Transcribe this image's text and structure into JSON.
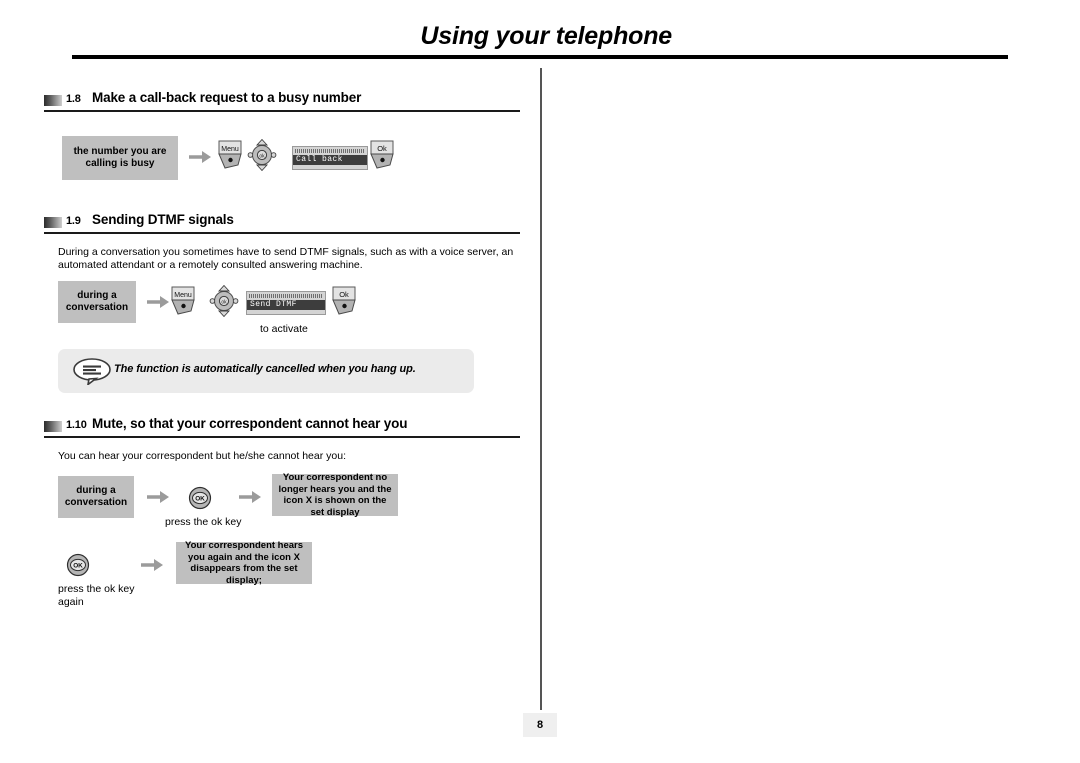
{
  "header": {
    "title": "Using your telephone"
  },
  "footer": {
    "page_number": "8"
  },
  "sections": [
    {
      "number": "1.8",
      "title": "Make a call-back request to a busy number",
      "steps": {
        "state_box": "the number you are calling is busy",
        "menu_key_label": "Menu",
        "lcd_text": "Call back",
        "ok_key_label": "Ok"
      }
    },
    {
      "number": "1.9",
      "title": "Sending DTMF signals",
      "intro": "During a conversation you sometimes have to send DTMF signals, such as with a voice server, an automated attendant or a remotely consulted answering machine.",
      "steps": {
        "state_box": "during a conversation",
        "menu_key_label": "Menu",
        "lcd_text": "Send DTMF",
        "ok_key_label": "Ok",
        "ok_caption": "to activate"
      },
      "note": {
        "text": "The function is automatically cancelled when you hang up."
      }
    },
    {
      "number": "1.10",
      "title": "Mute, so that your correspondent cannot hear you",
      "intro": "You can hear your correspondent but he/she cannot hear you:",
      "row1": {
        "state_box": "during a conversation",
        "ok_key_label": "OK",
        "ok_caption": "press the ok key",
        "result_box": "Your correspondent no longer hears you and the icon X is shown on the set display"
      },
      "row2": {
        "ok_key_label": "OK",
        "ok_caption": "press the ok key\nagain",
        "result_box": "Your correspondent hears you again and the icon X disappears from the set display;"
      }
    }
  ],
  "colors": {
    "gray_box": "#bfbfbf",
    "note_bg": "#ebebeb",
    "rule": "#000000",
    "divider": "#555555",
    "lcd_bar": "#3d3d3d"
  }
}
